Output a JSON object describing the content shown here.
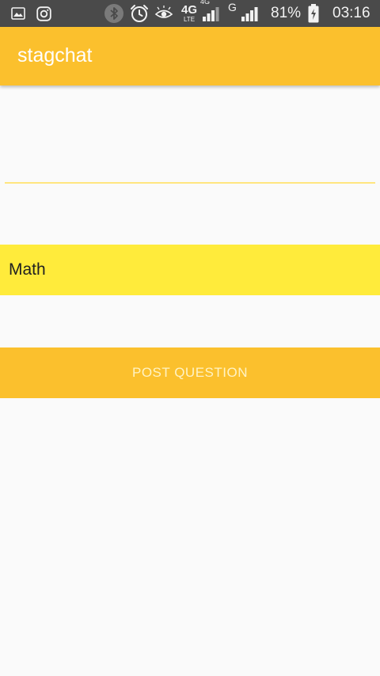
{
  "status_bar": {
    "network_type": "4G",
    "network_sub": "LTE",
    "network_type_2": "4G",
    "network_type_3": "G",
    "battery": "81%",
    "time": "03:16",
    "icons": [
      "gallery-icon",
      "instagram-icon",
      "bluetooth-icon",
      "alarm-icon",
      "eye-icon",
      "signal-icon",
      "battery-icon"
    ]
  },
  "app_bar": {
    "title": "stagchat"
  },
  "form": {
    "question_value": "",
    "question_placeholder": "",
    "subject_selected": "Math",
    "post_button_label": "POST QUESTION"
  },
  "colors": {
    "status_bar_bg": "#4a4a4a",
    "app_bar_bg": "#fbc02d",
    "subject_bg": "#ffeb3b",
    "button_bg": "#fbc02d",
    "page_bg": "#fafafa"
  }
}
